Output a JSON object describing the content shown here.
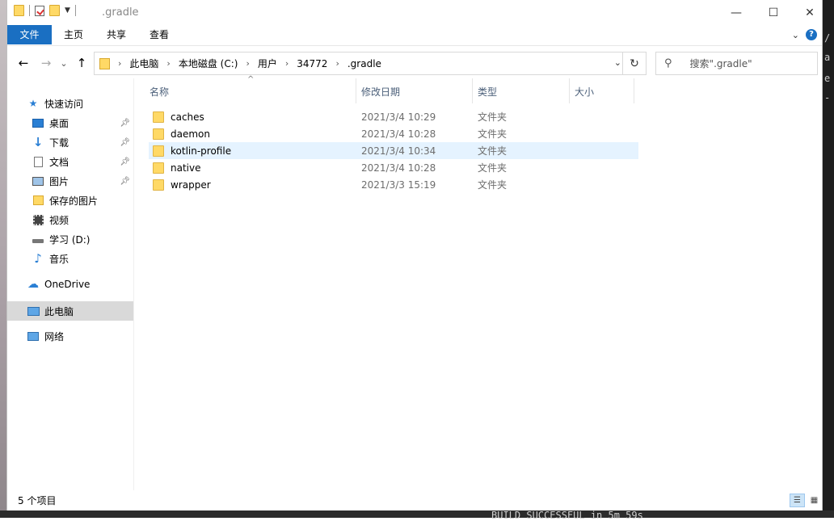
{
  "window": {
    "title": ".gradle",
    "controls": {
      "minimize": "—",
      "maximize": "☐",
      "close": "✕"
    }
  },
  "ribbon": {
    "tabs": [
      {
        "label": "文件"
      },
      {
        "label": "主页"
      },
      {
        "label": "共享"
      },
      {
        "label": "查看"
      }
    ]
  },
  "nav": {
    "back": "←",
    "forward": "→",
    "recent": "⌄",
    "up": "↑",
    "breadcrumbs": [
      "此电脑",
      "本地磁盘 (C:)",
      "用户",
      "34772",
      ".gradle"
    ],
    "separator": "›",
    "refresh": "↻",
    "search_placeholder": "搜索\".gradle\""
  },
  "sidebar": {
    "items": [
      {
        "label": "快速访问",
        "icon": "star-icon"
      },
      {
        "label": "桌面",
        "icon": "desktop-icon",
        "pinned": true
      },
      {
        "label": "下载",
        "icon": "download-icon",
        "pinned": true
      },
      {
        "label": "文档",
        "icon": "document-icon",
        "pinned": true
      },
      {
        "label": "图片",
        "icon": "picture-icon",
        "pinned": true
      },
      {
        "label": "保存的图片",
        "icon": "folder-icon"
      },
      {
        "label": "视频",
        "icon": "video-icon"
      },
      {
        "label": "学习 (D:)",
        "icon": "drive-icon"
      },
      {
        "label": "音乐",
        "icon": "music-icon"
      },
      {
        "label": "OneDrive",
        "icon": "cloud-icon"
      },
      {
        "label": "此电脑",
        "icon": "computer-icon",
        "selected": true
      },
      {
        "label": "网络",
        "icon": "network-icon"
      }
    ]
  },
  "columns": {
    "name": "名称",
    "date": "修改日期",
    "type": "类型",
    "size": "大小"
  },
  "files": [
    {
      "name": "caches",
      "date": "2021/3/4 10:29",
      "type": "文件夹"
    },
    {
      "name": "daemon",
      "date": "2021/3/4 10:28",
      "type": "文件夹"
    },
    {
      "name": "kotlin-profile",
      "date": "2021/3/4 10:34",
      "type": "文件夹",
      "hover": true
    },
    {
      "name": "native",
      "date": "2021/3/4 10:28",
      "type": "文件夹"
    },
    {
      "name": "wrapper",
      "date": "2021/3/3 15:19",
      "type": "文件夹"
    }
  ],
  "status": {
    "item_count": "5 个项目"
  },
  "background": {
    "terminal_text": "BUILD SUCCESSFUL in 5m 59s",
    "right_chars": [
      "/",
      "a",
      "e",
      "-"
    ]
  },
  "colors": {
    "accent": "#1a6fc2",
    "hover_row": "#e5f3ff",
    "selected_nav": "#d9d9d9",
    "folder": "#ffd966"
  }
}
